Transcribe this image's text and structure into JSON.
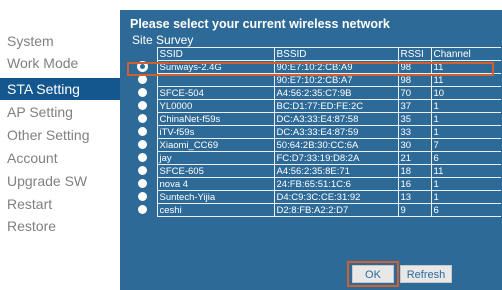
{
  "sidebar": {
    "items": [
      {
        "label": "System",
        "active": false
      },
      {
        "label": "Work Mode",
        "active": false
      },
      {
        "label": "STA Setting",
        "active": true
      },
      {
        "label": "AP Setting",
        "active": false
      },
      {
        "label": "Other Setting",
        "active": false
      },
      {
        "label": "Account",
        "active": false
      },
      {
        "label": "Upgrade SW",
        "active": false
      },
      {
        "label": "Restart",
        "active": false
      },
      {
        "label": "Restore",
        "active": false
      }
    ]
  },
  "main": {
    "title": "Please select your current wireless network",
    "survey_label": "Site Survey",
    "columns": [
      "SSID",
      "BSSID",
      "RSSI",
      "Channel"
    ],
    "rows": [
      {
        "ssid": "Sunways-2.4G",
        "bssid": "90:E7:10:2:CB:A9",
        "rssi": "98",
        "channel": "11",
        "selected": true
      },
      {
        "ssid": "",
        "bssid": "90:E7:10:2:CB:A7",
        "rssi": "98",
        "channel": "11",
        "selected": false
      },
      {
        "ssid": "SFCE-504",
        "bssid": "A4:56:2:35:C7:9B",
        "rssi": "70",
        "channel": "10",
        "selected": false
      },
      {
        "ssid": "YL0000",
        "bssid": "BC:D1:77:ED:FE:2C",
        "rssi": "37",
        "channel": "1",
        "selected": false
      },
      {
        "ssid": "ChinaNet-f59s",
        "bssid": "DC:A3:33:E4:87:58",
        "rssi": "35",
        "channel": "1",
        "selected": false
      },
      {
        "ssid": "iTV-f59s",
        "bssid": "DC:A3:33:E4:87:59",
        "rssi": "33",
        "channel": "1",
        "selected": false
      },
      {
        "ssid": "Xiaomi_CC69",
        "bssid": "50:64:2B:30:CC:6A",
        "rssi": "30",
        "channel": "7",
        "selected": false
      },
      {
        "ssid": "jay",
        "bssid": "FC:D7:33:19:D8:2A",
        "rssi": "21",
        "channel": "6",
        "selected": false
      },
      {
        "ssid": "SFCE-605",
        "bssid": "A4:56:2:35:8E:71",
        "rssi": "18",
        "channel": "11",
        "selected": false
      },
      {
        "ssid": "nova 4",
        "bssid": "24:FB:65:51:1C:6",
        "rssi": "16",
        "channel": "1",
        "selected": false
      },
      {
        "ssid": "Suntech-Yijia",
        "bssid": "D4:C9:3C:CE:31:92",
        "rssi": "13",
        "channel": "1",
        "selected": false
      },
      {
        "ssid": "ceshi",
        "bssid": "D2:8:FB:A2:2:D7",
        "rssi": "9",
        "channel": "6",
        "selected": false
      }
    ]
  },
  "buttons": {
    "ok": "OK",
    "refresh": "Refresh"
  },
  "colors": {
    "panel": "#2d6a97",
    "active_nav": "#14578f",
    "highlight": "#d2602e"
  }
}
